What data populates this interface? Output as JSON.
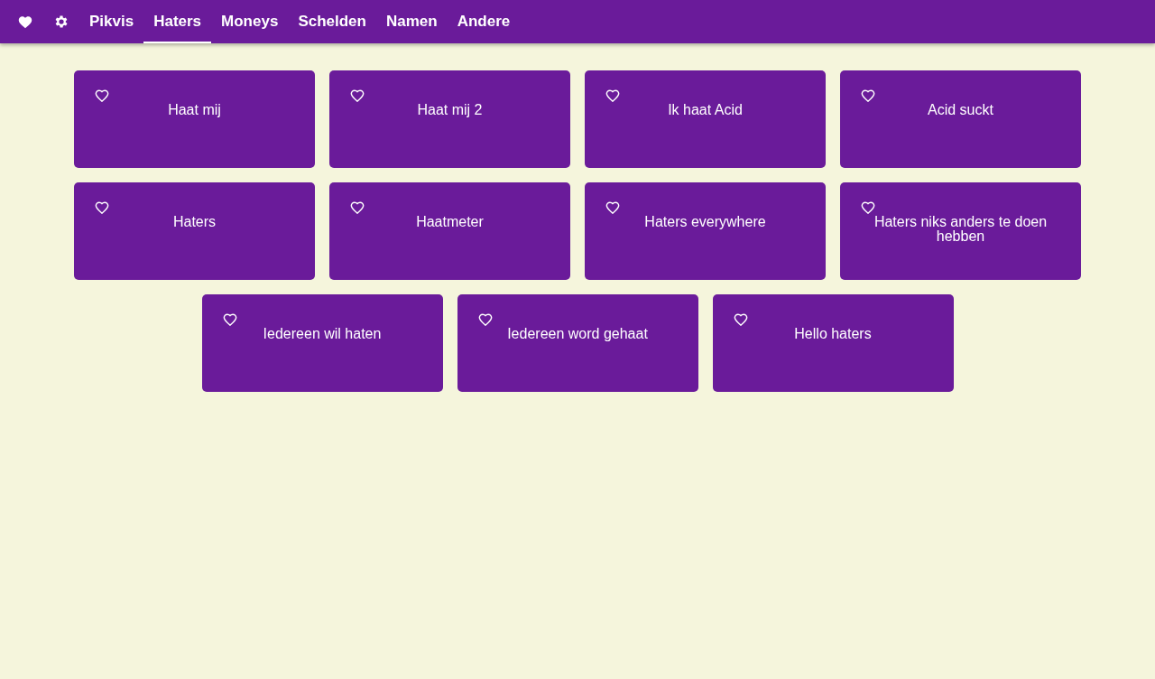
{
  "tabs": [
    {
      "label": "Pikvis",
      "selected": false
    },
    {
      "label": "Haters",
      "selected": true
    },
    {
      "label": "Moneys",
      "selected": false
    },
    {
      "label": "Schelden",
      "selected": false
    },
    {
      "label": "Namen",
      "selected": false
    },
    {
      "label": "Andere",
      "selected": false
    }
  ],
  "sounds": [
    {
      "title": "Haat mij",
      "favorite": false
    },
    {
      "title": "Haat mij 2",
      "favorite": false
    },
    {
      "title": "Ik haat Acid",
      "favorite": false
    },
    {
      "title": "Acid suckt",
      "favorite": false
    },
    {
      "title": "Haters",
      "favorite": false
    },
    {
      "title": "Haatmeter",
      "favorite": false
    },
    {
      "title": "Haters everywhere",
      "favorite": false
    },
    {
      "title": "Haters niks anders te doen hebben",
      "favorite": false
    },
    {
      "title": "Iedereen wil haten",
      "favorite": false
    },
    {
      "title": "Iedereen word gehaat",
      "favorite": false
    },
    {
      "title": "Hello haters",
      "favorite": false
    }
  ]
}
